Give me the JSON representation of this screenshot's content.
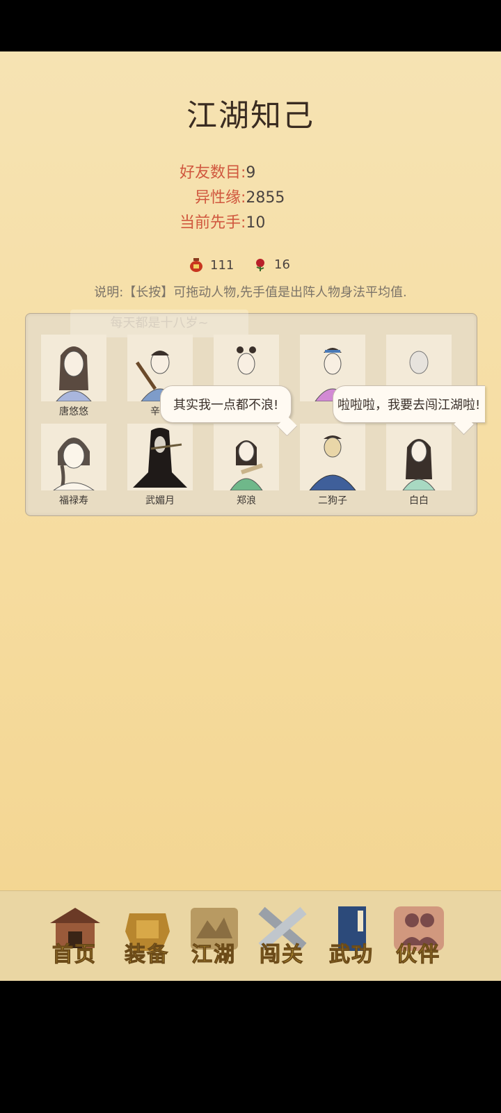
{
  "page": {
    "title": "江湖知己"
  },
  "stats": [
    {
      "key": "好友数目:",
      "value": "9"
    },
    {
      "key": "异性缘:",
      "value": "2855"
    },
    {
      "key": "当前先手:",
      "value": "10"
    }
  ],
  "resources": {
    "jar_count": "111",
    "rose_count": "16"
  },
  "description": "说明:【长按】可拖动人物,先手值是出阵人物身法平均值.",
  "ghost_text": "每天都是十八岁~",
  "characters": [
    {
      "name": "唐悠悠"
    },
    {
      "name": "辛一"
    },
    {
      "name": ""
    },
    {
      "name": ""
    },
    {
      "name": ""
    },
    {
      "name": "福禄寿"
    },
    {
      "name": "武媚月"
    },
    {
      "name": "郑浪"
    },
    {
      "name": "二狗子"
    },
    {
      "name": "白白"
    }
  ],
  "bubbles": [
    {
      "text": "其实我一点都不浪!"
    },
    {
      "text": "啦啦啦，我要去闯江湖啦!"
    }
  ],
  "tabs": [
    {
      "label": "首页",
      "icon": "house-icon"
    },
    {
      "label": "装备",
      "icon": "armor-icon"
    },
    {
      "label": "江湖",
      "icon": "map-scroll-icon"
    },
    {
      "label": "闯关",
      "icon": "crossed-swords-icon"
    },
    {
      "label": "武功",
      "icon": "martial-book-icon"
    },
    {
      "label": "伙伴",
      "icon": "companions-icon",
      "active": true
    }
  ],
  "colors": {
    "stat_key": "#d0573e",
    "tab_label": "#e9c243",
    "background": "#f6dc9f"
  }
}
